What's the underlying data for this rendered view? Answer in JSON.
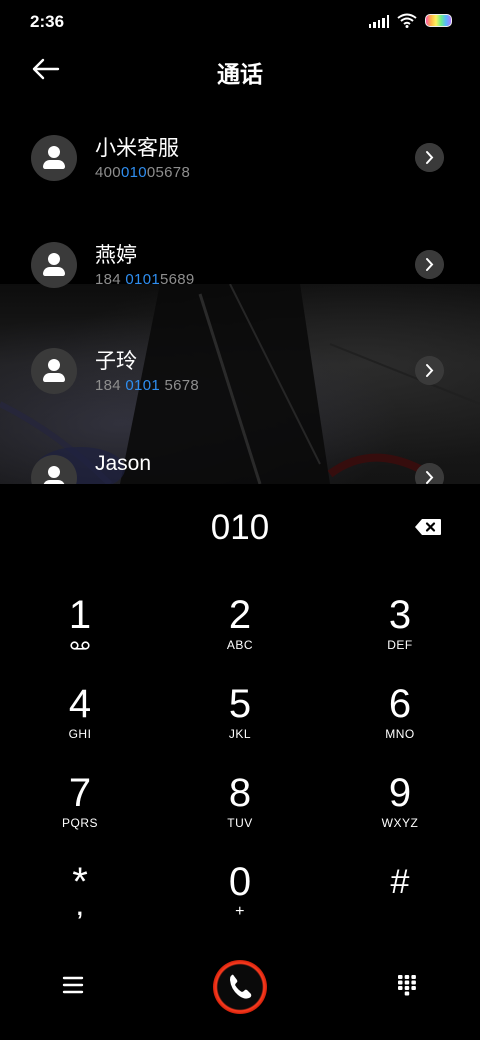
{
  "status_bar": {
    "time": "2:36",
    "icons": [
      "signal-icon",
      "wifi-icon",
      "battery-icon"
    ]
  },
  "header": {
    "title": "通话",
    "back_icon": "back-arrow-icon"
  },
  "contacts": [
    {
      "name": "小米客服",
      "number_prefix": "400",
      "number_match": "010",
      "number_suffix": "05678"
    },
    {
      "name": "燕婷",
      "number_prefix": "184 ",
      "number_match": "0101",
      "number_suffix": "5689"
    },
    {
      "name": "子玲",
      "number_prefix": "184 ",
      "number_match": "0101",
      "number_suffix": " 5678"
    },
    {
      "name": "Jason",
      "number_prefix": "",
      "number_match": "",
      "number_suffix": ""
    }
  ],
  "dialer": {
    "display_value": "010",
    "keys": [
      {
        "digit": "1",
        "letters": ""
      },
      {
        "digit": "2",
        "letters": "ABC"
      },
      {
        "digit": "3",
        "letters": "DEF"
      },
      {
        "digit": "4",
        "letters": "GHI"
      },
      {
        "digit": "5",
        "letters": "JKL"
      },
      {
        "digit": "6",
        "letters": "MNO"
      },
      {
        "digit": "7",
        "letters": "PQRS"
      },
      {
        "digit": "8",
        "letters": "TUV"
      },
      {
        "digit": "9",
        "letters": "WXYZ"
      },
      {
        "digit": "*",
        "letters": ","
      },
      {
        "digit": "0",
        "letters": "+"
      },
      {
        "digit": "#",
        "letters": ""
      }
    ]
  },
  "bottom_bar": {
    "icons": [
      "menu-icon",
      "phone-call-icon",
      "keypad-icon"
    ]
  },
  "colors": {
    "background": "#000000",
    "highlight": "#2f8ef0",
    "secondary_text": "#8e8e8e",
    "call_ring": "#ff3b1f"
  }
}
